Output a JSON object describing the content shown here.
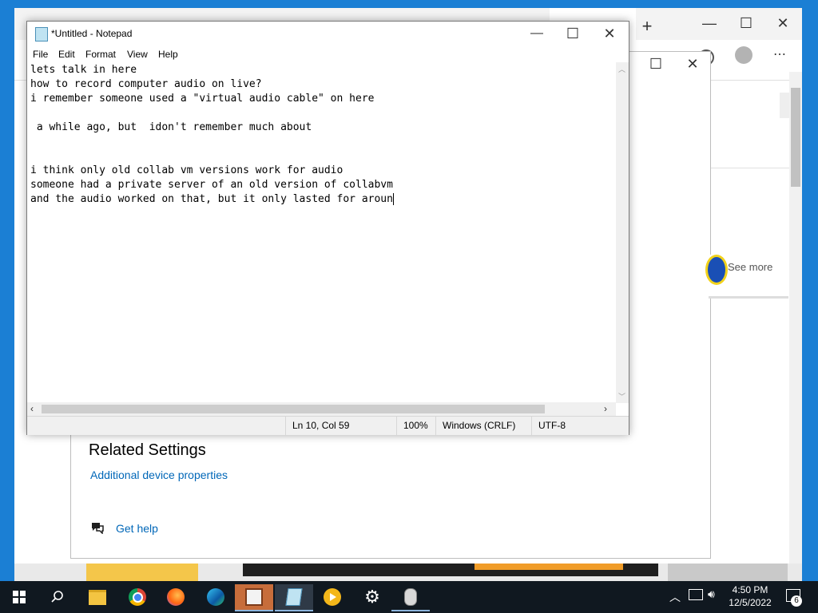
{
  "notepad": {
    "title": "*Untitled - Notepad",
    "menu": [
      "File",
      "Edit",
      "Format",
      "View",
      "Help"
    ],
    "lines": [
      "lets talk in here",
      "how to record computer audio on live?",
      "i remember someone used a \"virtual audio cable\" on here",
      "",
      " a while ago, but  idon't remember much about",
      "",
      "",
      "i think only old collab vm versions work for audio",
      "someone had a private server of an old version of collabvm",
      "and the audio worked on that, but it only lasted for aroun"
    ],
    "status": {
      "position": "Ln 10, Col 59",
      "zoom": "100%",
      "line_ending": "Windows (CRLF)",
      "encoding": "UTF-8"
    }
  },
  "settings": {
    "related_heading": "Related Settings",
    "additional_link": "Additional device properties",
    "help_link": "Get help",
    "see_more": "See more"
  },
  "taskbar": {
    "time": "4:50 PM",
    "date": "12/5/2022",
    "notification_count": "6"
  },
  "colors": {
    "desktop": "#1b7fd4",
    "link": "#0067b8",
    "taskbar": "#101820"
  }
}
